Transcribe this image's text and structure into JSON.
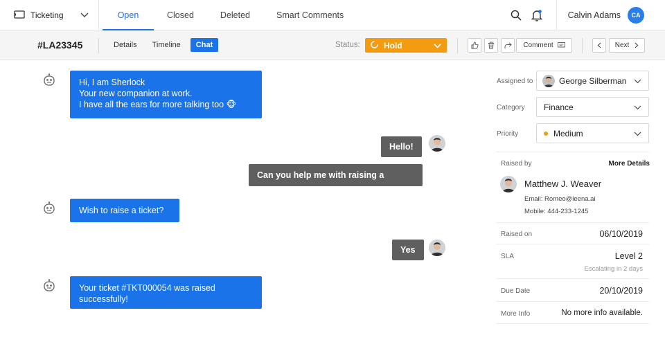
{
  "nav": {
    "app_name": "Ticketing",
    "tabs": [
      {
        "label": "Open",
        "active": true
      },
      {
        "label": "Closed",
        "active": false
      },
      {
        "label": "Deleted",
        "active": false
      },
      {
        "label": "Smart Comments",
        "active": false
      }
    ],
    "user_name": "Calvin Adams",
    "user_initials": "CA"
  },
  "subbar": {
    "ticket_id": "#LA23345",
    "tabs": [
      {
        "label": "Details",
        "active": false
      },
      {
        "label": "Timeline",
        "active": false
      },
      {
        "label": "Chat",
        "active": true
      }
    ],
    "status_label": "Status:",
    "status_value": "Hold",
    "comment_label": "Comment",
    "next_label": "Next"
  },
  "chat": {
    "messages": [
      {
        "from": "bot",
        "lines": [
          "Hi, I am Sherlock",
          "Your new companion at work.",
          "I have all the ears for more talking too 🐵"
        ]
      },
      {
        "from": "user",
        "text": "Hello!"
      },
      {
        "from": "user",
        "text": "Can you help me with raising a ticket?"
      },
      {
        "from": "bot",
        "lines": [
          "Wish to raise a ticket?"
        ]
      },
      {
        "from": "user",
        "text": "Yes"
      },
      {
        "from": "bot",
        "lines": [
          "Your ticket #TKT000054 was raised",
          "successfully!"
        ]
      }
    ]
  },
  "panel": {
    "assigned_label": "Assigned to",
    "assigned_value": "George Silberman",
    "category_label": "Category",
    "category_value": "Finance",
    "priority_label": "Priority",
    "priority_value": "Medium",
    "priority_color": "#f39c12",
    "raised_by_label": "Raised by",
    "more_details": "More Details",
    "raiser_name": "Matthew J. Weaver",
    "raiser_email": "Email: Romeo@leena.ai",
    "raiser_mobile": "Mobile: 444-233-1245",
    "raised_on_label": "Raised on",
    "raised_on_value": "06/10/2019",
    "sla_label": "SLA",
    "sla_value": "Level 2",
    "sla_note": "Escalating in 2 days",
    "due_label": "Due Date",
    "due_value": "20/10/2019",
    "more_info_label": "More Info",
    "more_info_value": "No more info available."
  }
}
